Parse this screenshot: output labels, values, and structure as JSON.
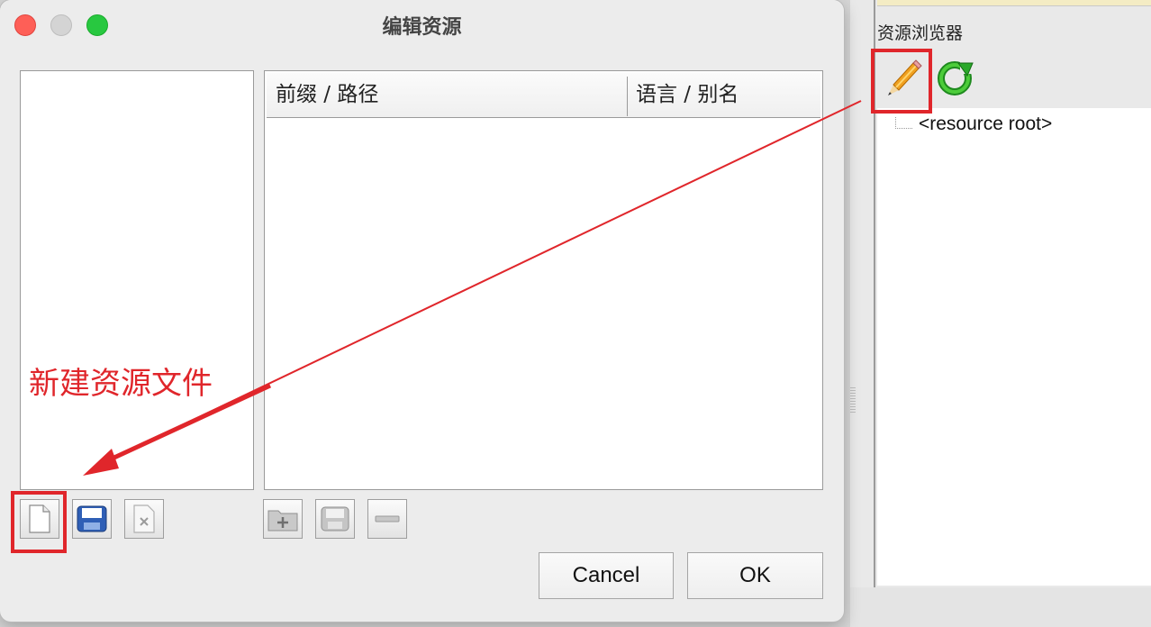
{
  "dialog": {
    "title": "编辑资源",
    "table_headers": [
      "前缀 / 路径",
      "语言 / 别名"
    ],
    "buttons": {
      "cancel": "Cancel",
      "ok": "OK"
    }
  },
  "resource_browser": {
    "title": "资源浏览器",
    "tree_items": [
      "<resource root>"
    ],
    "tools": [
      "pencil-edit-icon",
      "refresh-icon"
    ]
  },
  "annotation": {
    "text": "新建资源文件",
    "color": "#e0262b"
  },
  "colors": {
    "traffic_close": "#fe5f57",
    "traffic_min": "#d4d4d4",
    "traffic_max": "#28c840"
  }
}
